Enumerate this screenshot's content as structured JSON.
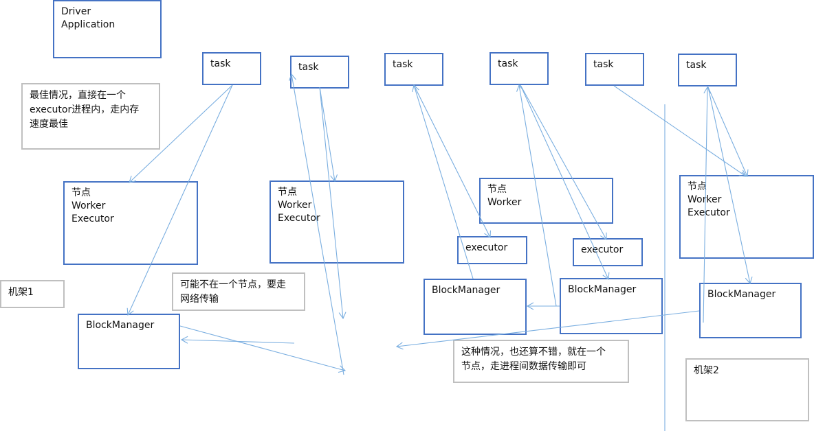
{
  "driver": {
    "label": "Driver\nApplication"
  },
  "tasks": [
    {
      "label": "task"
    },
    {
      "label": "task"
    },
    {
      "label": "task"
    },
    {
      "label": "task"
    },
    {
      "label": "task"
    },
    {
      "label": "task"
    }
  ],
  "notes": {
    "best_case": "最佳情况，直接在一个\nexecutor进程内，走内存\n速度最佳",
    "rack1": "机架1",
    "network": "可能不在一个节点，要走\n网络传输",
    "same_node": "这种情况，也还算不错，就在一个\n节点，走进程间数据传输即可",
    "rack2": "机架2"
  },
  "nodes": [
    {
      "label": "节点\nWorker\nExecutor"
    },
    {
      "label": "节点\nWorker\nExecutor"
    },
    {
      "label": "节点\nWorker"
    },
    {
      "label": "节点\nWorker\nExecutor"
    }
  ],
  "executors": [
    {
      "label": "executor"
    },
    {
      "label": "executor"
    }
  ],
  "block_managers": [
    {
      "label": "BlockManager"
    },
    {
      "label": "BlockManager"
    },
    {
      "label": "BlockManager"
    },
    {
      "label": "BlockManager"
    }
  ],
  "colors": {
    "box_border": "#4472c4",
    "note_border": "#bfbfbf",
    "arrow": "#7aaee0"
  }
}
